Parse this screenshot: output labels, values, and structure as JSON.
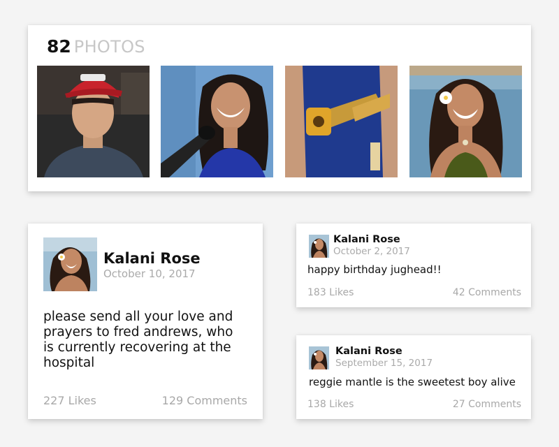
{
  "photos": {
    "count": "82",
    "label": "PHOTOS",
    "items": [
      {
        "icon": "photo-man-red-cap"
      },
      {
        "icon": "photo-woman-microphone"
      },
      {
        "icon": "photo-costume-detail"
      },
      {
        "icon": "photo-woman-flower-sea"
      }
    ]
  },
  "posts": [
    {
      "author": "Kalani Rose",
      "date": "October 10, 2017",
      "text": "please send all your love and prayers to fred andrews, who is currently recovering at the hospital",
      "likes": "227 Likes",
      "comments": "129 Comments"
    },
    {
      "author": "Kalani Rose",
      "date": "October 2, 2017",
      "text": "happy birthday jughead!!",
      "likes": "183 Likes",
      "comments": "42 Comments"
    },
    {
      "author": "Kalani Rose",
      "date": "September 15, 2017",
      "text": "reggie mantle is the sweetest boy alive",
      "likes": "138 Likes",
      "comments": "27 Comments"
    }
  ]
}
